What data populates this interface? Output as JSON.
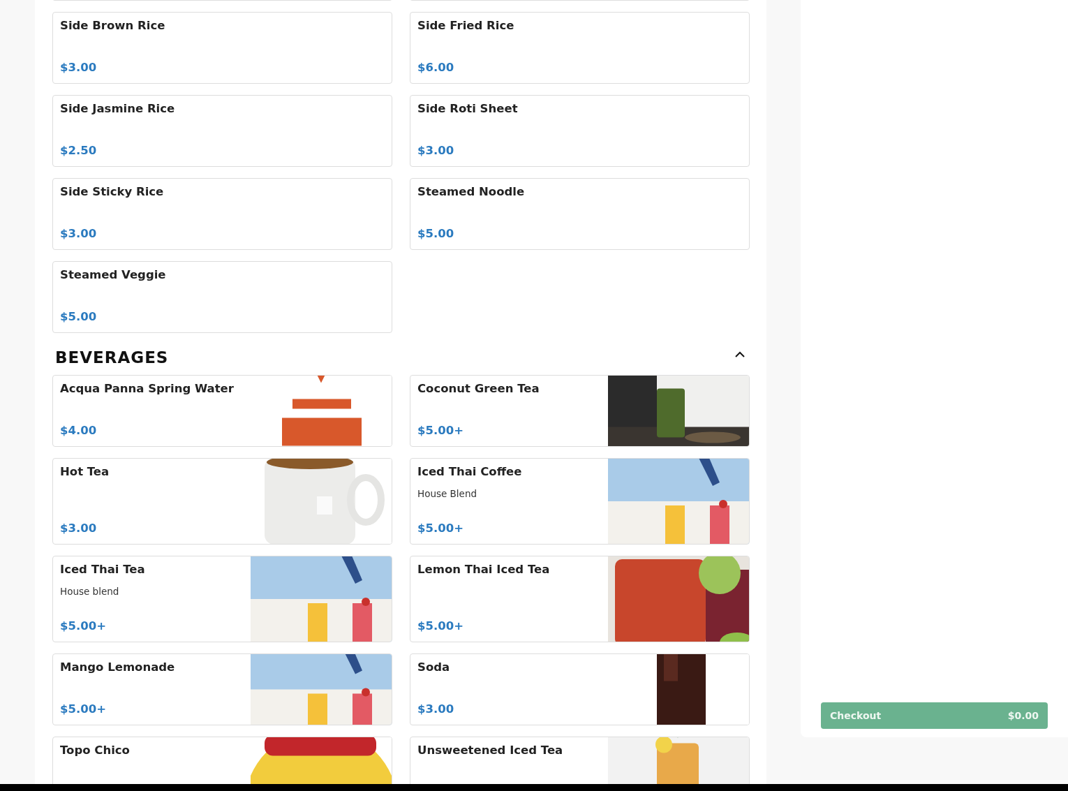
{
  "sides": [
    {
      "name": "Side Brown Rice",
      "price": "$3.00"
    },
    {
      "name": "Side Fried Rice",
      "price": "$6.00"
    },
    {
      "name": "Side Jasmine Rice",
      "price": "$2.50"
    },
    {
      "name": "Side Roti Sheet",
      "price": "$3.00"
    },
    {
      "name": "Side Sticky Rice",
      "price": "$3.00"
    },
    {
      "name": "Steamed Noodle",
      "price": "$5.00"
    },
    {
      "name": "Steamed Veggie",
      "price": "$5.00"
    }
  ],
  "section": {
    "title": "BEVERAGES",
    "expanded": true
  },
  "beverages": [
    {
      "name": "Acqua Panna Spring Water",
      "price": "$4.00",
      "image": true
    },
    {
      "name": "Coconut Green Tea",
      "price": "$5.00+",
      "image": true
    },
    {
      "name": "Hot Tea",
      "price": "$3.00",
      "image": true
    },
    {
      "name": "Iced Thai Coffee",
      "description": "House Blend",
      "price": "$5.00+",
      "image": true
    },
    {
      "name": "Iced Thai Tea",
      "description": "House blend",
      "price": "$5.00+",
      "image": true
    },
    {
      "name": "Lemon Thai Iced Tea",
      "price": "$5.00+",
      "image": true
    },
    {
      "name": "Mango Lemonade",
      "price": "$5.00+",
      "image": true
    },
    {
      "name": "Soda",
      "price": "$3.00",
      "image": true
    },
    {
      "name": "Topo Chico",
      "image": true
    },
    {
      "name": "Unsweetened Iced Tea",
      "image": true
    }
  ],
  "checkout": {
    "label": "Checkout",
    "total": "$0.00"
  }
}
